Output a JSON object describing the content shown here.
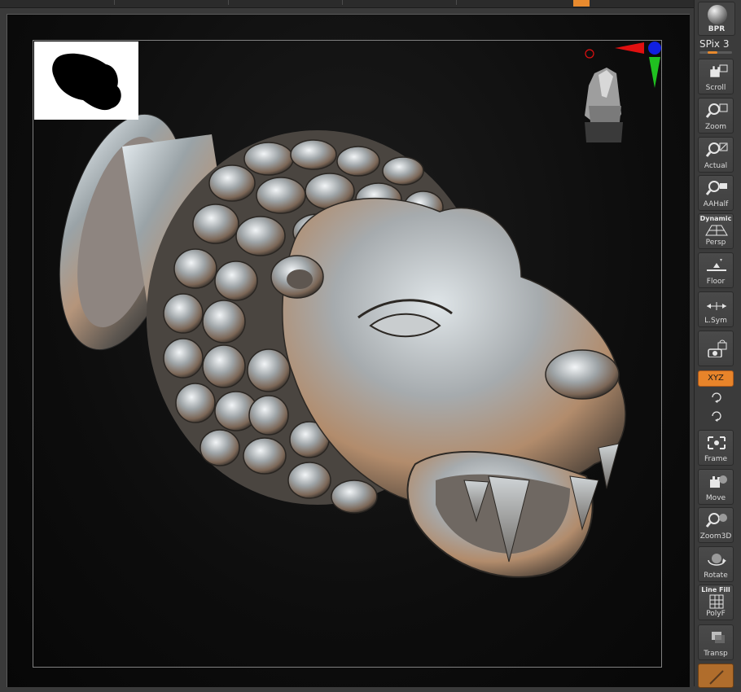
{
  "viewport": {
    "colors": {
      "accent": "#e88a2e",
      "gizmo_x": "#e01010",
      "gizmo_y": "#20c020",
      "gizmo_z": "#1020e0"
    }
  },
  "navigator": {
    "icon": "model-silhouette-icon"
  },
  "gizmo": {
    "icon": "orientation-gizmo-icon"
  },
  "shelf": {
    "bpr": {
      "label": "BPR"
    },
    "spix": {
      "label": "SPix 3"
    },
    "buttons": [
      {
        "label": "Scroll",
        "icon": "hand-scroll-icon"
      },
      {
        "label": "Zoom",
        "icon": "zoom-icon"
      },
      {
        "label": "Actual",
        "icon": "actual-size-icon"
      },
      {
        "label": "AAHalf",
        "icon": "aahalf-icon"
      },
      {
        "label": "Persp",
        "top_label": "Dynamic",
        "icon": "perspective-grid-icon"
      },
      {
        "label": "Floor",
        "icon": "floor-icon"
      },
      {
        "label": "L.Sym",
        "icon": "local-symmetry-icon"
      },
      {
        "label": "",
        "icon": "lock-camera-icon"
      },
      {
        "label": "Frame",
        "icon": "frame-icon"
      },
      {
        "label": "Move",
        "icon": "move-hand-icon"
      },
      {
        "label": "Zoom3D",
        "icon": "zoom3d-icon"
      },
      {
        "label": "Rotate",
        "icon": "rotate-icon"
      },
      {
        "label": "PolyF",
        "top_label": "Line Fill",
        "icon": "polyframe-icon"
      },
      {
        "label": "Transp",
        "icon": "transparency-icon"
      }
    ],
    "xyz": {
      "label": "XYZ"
    }
  }
}
